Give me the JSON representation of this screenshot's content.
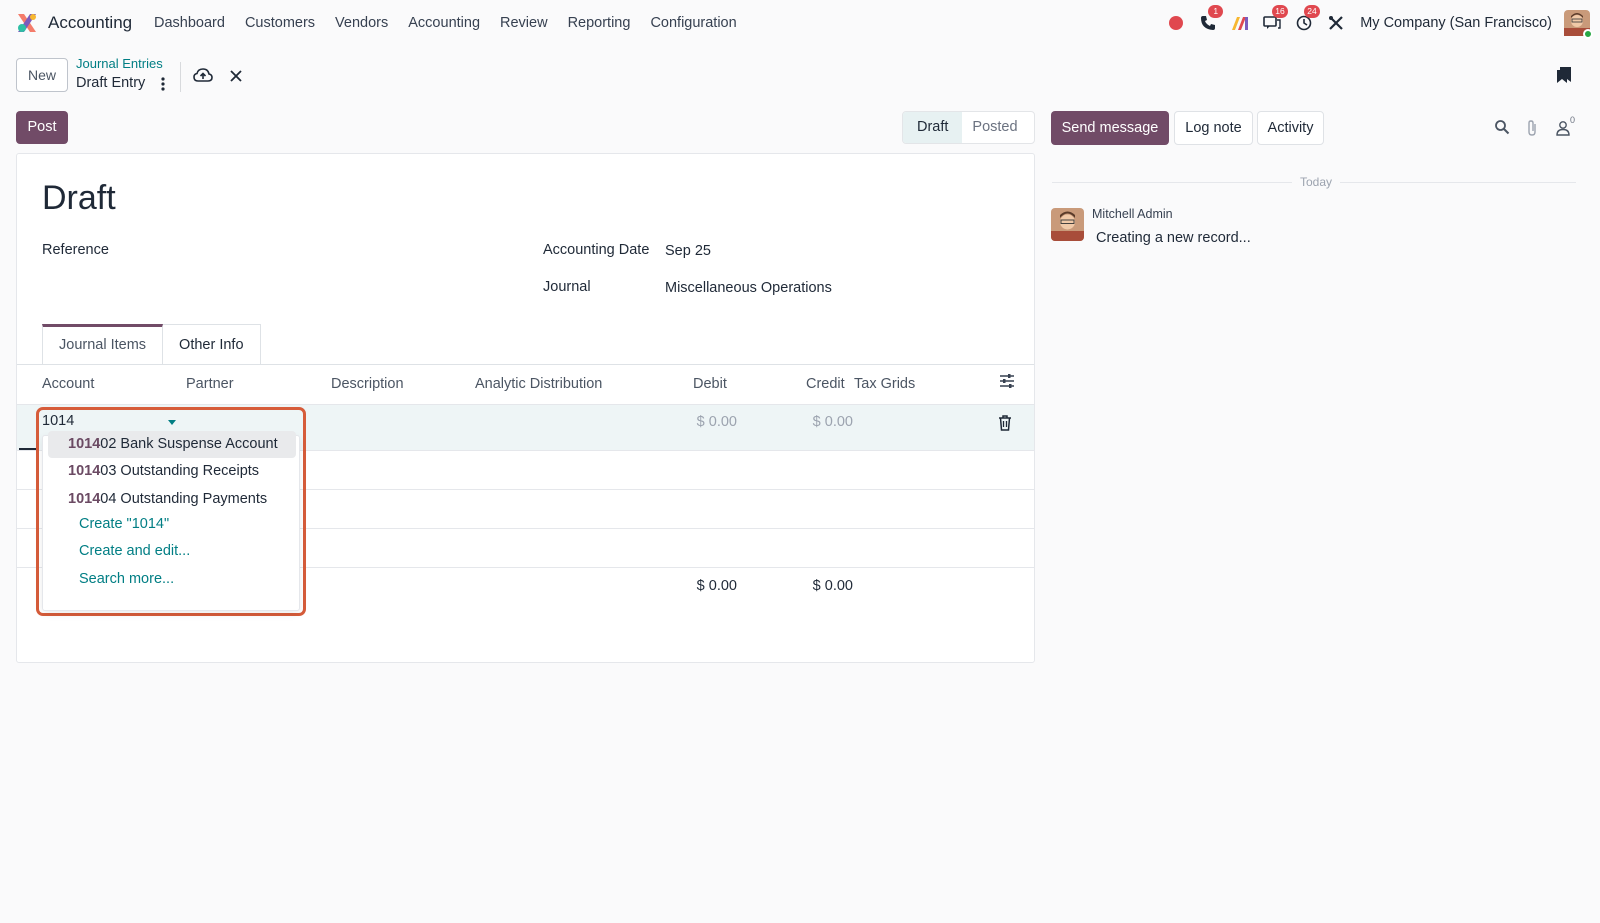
{
  "navbar": {
    "app_name": "Accounting",
    "menu": [
      "Dashboard",
      "Customers",
      "Vendors",
      "Accounting",
      "Review",
      "Reporting",
      "Configuration"
    ],
    "badges": {
      "phone": "1",
      "messages": "16",
      "activities": "24"
    },
    "company": "My Company (San Francisco)"
  },
  "control": {
    "new_label": "New",
    "breadcrumb_parent": "Journal Entries",
    "breadcrumb_current": "Draft Entry",
    "post_label": "Post",
    "status": {
      "draft": "Draft",
      "posted": "Posted",
      "active": "Draft"
    }
  },
  "form": {
    "title": "Draft",
    "reference_label": "Reference",
    "accounting_date_label": "Accounting Date",
    "accounting_date": "Sep 25",
    "journal_label": "Journal",
    "journal": "Miscellaneous Operations",
    "tabs": [
      "Journal Items",
      "Other Info"
    ],
    "columns": [
      "Account",
      "Partner",
      "Description",
      "Analytic Distribution",
      "Debit",
      "Credit",
      "Tax Grids"
    ],
    "line": {
      "account_input": "1014",
      "debit": "$ 0.00",
      "credit": "$ 0.00"
    },
    "totals": {
      "debit": "$ 0.00",
      "credit": "$ 0.00"
    }
  },
  "dropdown": {
    "items": [
      {
        "match": "1014",
        "rest": "02 Bank Suspense Account"
      },
      {
        "match": "1014",
        "rest": "03 Outstanding Receipts"
      },
      {
        "match": "1014",
        "rest": "04 Outstanding Payments"
      }
    ],
    "create_label": "Create \"1014\"",
    "create_edit_label": "Create and edit...",
    "search_more_label": "Search more..."
  },
  "chatter": {
    "send_message": "Send message",
    "log_note": "Log note",
    "activity": "Activity",
    "followers_count": "0",
    "date_separator": "Today",
    "message_author": "Mitchell Admin",
    "message_body": "Creating a new record..."
  },
  "colors": {
    "brand": "#714b67",
    "link": "#017e84",
    "highlight": "#d65c3a",
    "badge": "#e0484f"
  }
}
